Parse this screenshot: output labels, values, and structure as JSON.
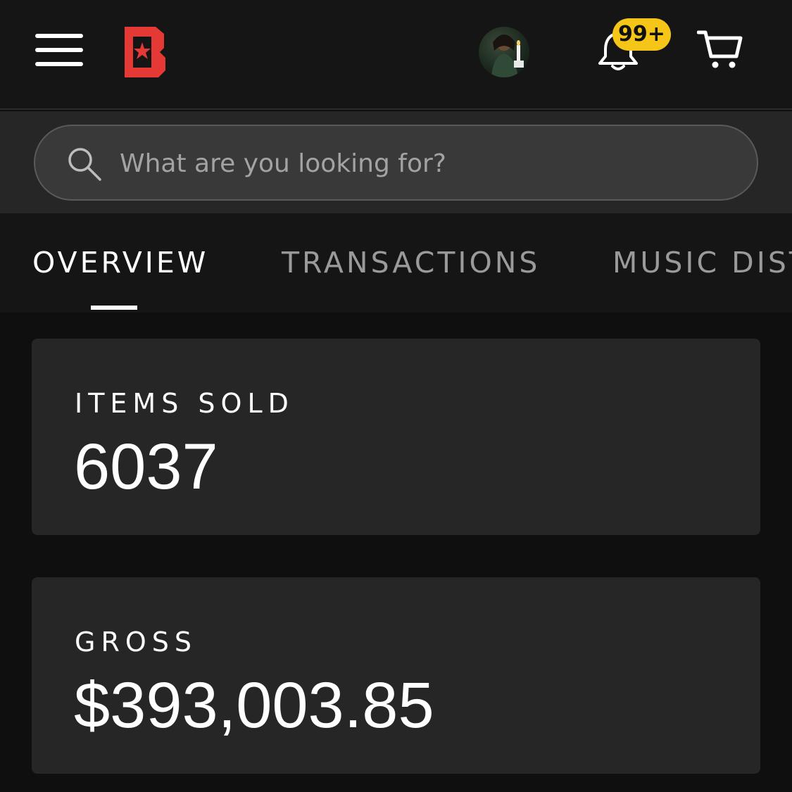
{
  "header": {
    "menu_icon": "hamburger-menu-icon",
    "logo_icon": "beatstars-logo-icon",
    "avatar_icon": "user-avatar",
    "notifications": {
      "icon": "bell-icon",
      "badge": "99+"
    },
    "cart_icon": "shopping-cart-icon",
    "brand_color": "#e53935",
    "badge_color": "#f5c518"
  },
  "search": {
    "icon": "search-icon",
    "placeholder": "What are you looking for?",
    "value": ""
  },
  "tabs": [
    {
      "label": "OVERVIEW",
      "active": true
    },
    {
      "label": "TRANSACTIONS",
      "active": false
    },
    {
      "label": "MUSIC DIST",
      "active": false
    }
  ],
  "stats": [
    {
      "label": "ITEMS SOLD",
      "value": "6037"
    },
    {
      "label": "GROSS",
      "value": "$393,003.85"
    }
  ]
}
